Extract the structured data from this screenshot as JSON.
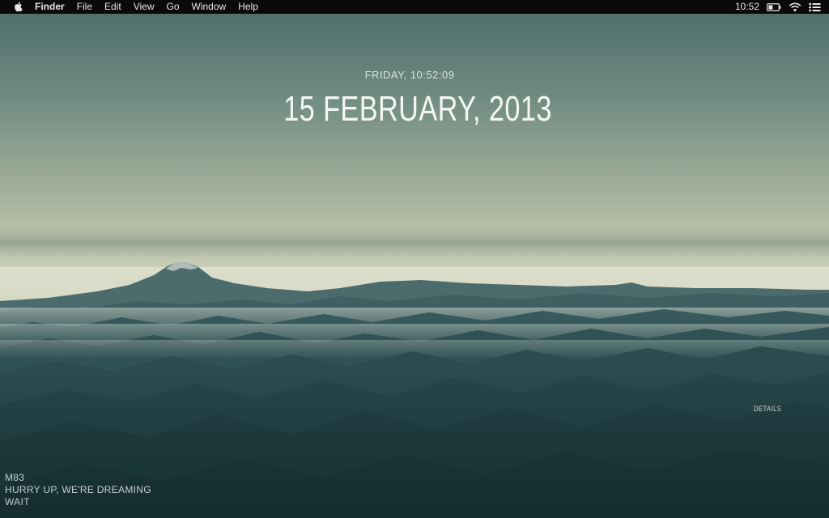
{
  "menubar": {
    "apple_icon": "apple-logo-icon",
    "app_name": "Finder",
    "items": [
      "File",
      "Edit",
      "View",
      "Go",
      "Window",
      "Help"
    ],
    "clock": "10:52",
    "status_icons": [
      "battery-icon",
      "wifi-icon",
      "notification-center-icon"
    ]
  },
  "widget": {
    "weekday_time": "FRIDAY, 10:52:09",
    "date": "15 FEBRUARY, 2013",
    "details_label": "DETAILS"
  },
  "now_playing": {
    "artist": "M83",
    "album": "HURRY UP, WE'RE DREAMING",
    "track": "WAIT"
  },
  "colors": {
    "menubar_bg": "#0a0a0a",
    "sky_top": "#4d6e6a",
    "sky_horizon": "#c8cfb8",
    "mountains": "#254347"
  }
}
